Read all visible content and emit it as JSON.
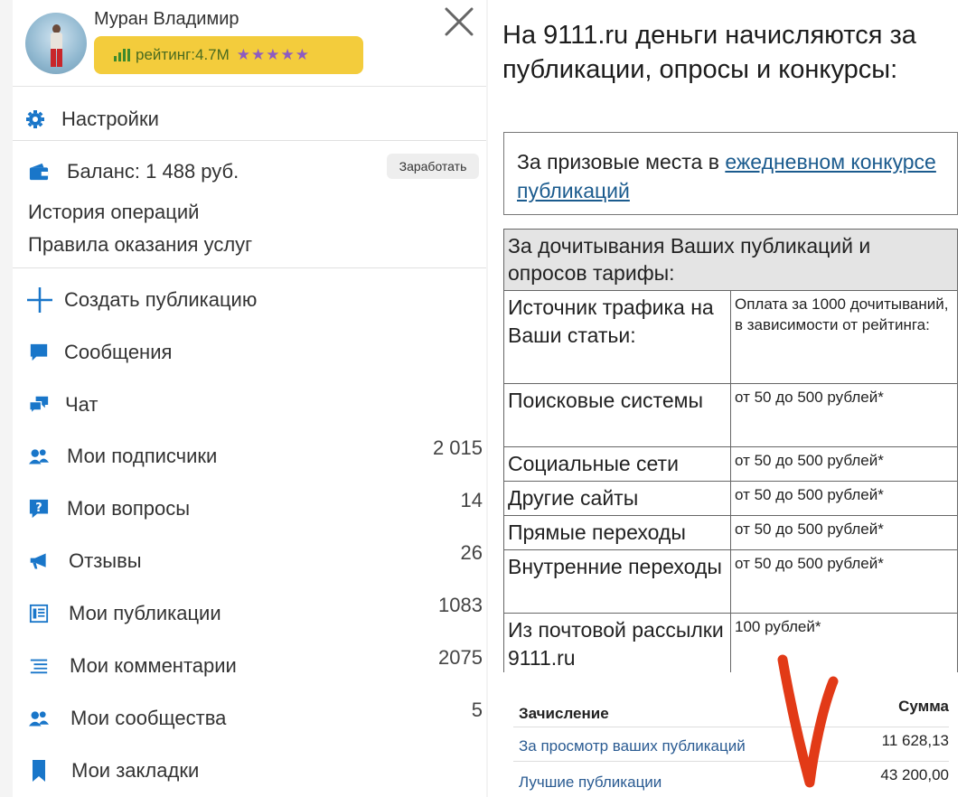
{
  "profile": {
    "name": "Муран Владимир",
    "rating": "рейтинг:4.7M",
    "stars": "★★★★★"
  },
  "menu": {
    "settings": "Настройки",
    "balance": "Баланс: 1 488 руб.",
    "earn_button": "Заработать",
    "history": "История операций",
    "rules": "Правила оказания услуг",
    "items": [
      {
        "label": "Создать публикацию",
        "count": ""
      },
      {
        "label": "Сообщения",
        "count": ""
      },
      {
        "label": "Чат",
        "count": ""
      },
      {
        "label": "Мои подписчики",
        "count": "2 015"
      },
      {
        "label": "Мои вопросы",
        "count": "14"
      },
      {
        "label": "Отзывы",
        "count": "26"
      },
      {
        "label": "Мои публикации",
        "count": "1083"
      },
      {
        "label": "Мои комментарии",
        "count": "2075"
      },
      {
        "label": "Мои сообщества",
        "count": "5"
      },
      {
        "label": "Мои закладки",
        "count": ""
      }
    ]
  },
  "article": {
    "intro": "На 9111.ru деньги начисляются за публикации, опросы и конкурсы:",
    "prize_text": "За призовые места в ",
    "prize_link": "ежедневном конкурсе публикаций",
    "table_title": "За дочитывания Ваших публикаций и опросов тарифы:",
    "col_source": "Источник трафика на Ваши статьи:",
    "col_payment": "Оплата за 1000 дочитываний, в зависимости от рейтинга:",
    "rows": [
      {
        "source": "Поисковые системы",
        "payment": "от 50 до 500 рублей*"
      },
      {
        "source": "Социальные сети",
        "payment": "от 50 до 500 рублей*"
      },
      {
        "source": "Другие сайты",
        "payment": "от 50 до 500 рублей*"
      },
      {
        "source": "Прямые переходы",
        "payment": "от 50 до 500 рублей*"
      },
      {
        "source": "Внутренние переходы",
        "payment": "от 50 до 500 рублей*"
      },
      {
        "source": "Из почтовой рассылки 9111.ru",
        "payment": "100 рублей*"
      }
    ]
  },
  "accrual": {
    "col_name": "Зачисление",
    "col_sum": "Сумма",
    "rows": [
      {
        "label": "За просмотр ваших публикаций",
        "amount": "11 628,13"
      },
      {
        "label": "Лучшие публикации",
        "amount": "43 200,00"
      }
    ]
  },
  "colors": {
    "accent_blue": "#2a5b92",
    "menu_icon_blue": "#1976c9",
    "rating_yellow": "#f3cc3c",
    "mark_red": "#e23a17"
  }
}
